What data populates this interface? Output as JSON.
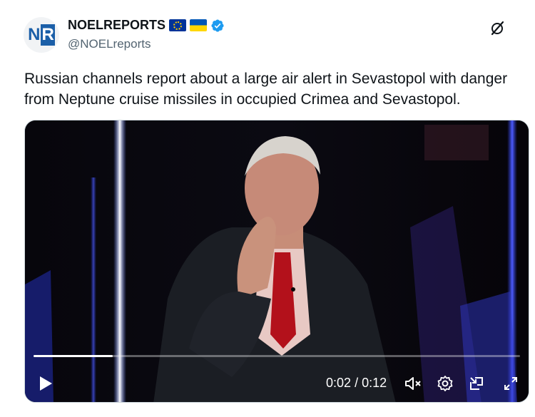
{
  "author": {
    "display_name": "NOELREPORTS",
    "handle": "@NOELreports",
    "avatar_text_left": "N",
    "avatar_text_right": "R",
    "badges": [
      "eu-flag-icon",
      "ukraine-flag-icon",
      "verified-badge-icon"
    ]
  },
  "tweet": {
    "text": "Russian channels report about a large air alert in Sevastopol with danger from Neptune cruise missiles in occupied Crimea and Sevastopol."
  },
  "video": {
    "current_time": "0:02",
    "separator": "/",
    "duration": "0:12",
    "progress_fraction": 0.163,
    "muted": true
  },
  "colors": {
    "text_primary": "#0f1419",
    "text_secondary": "#536471",
    "verified_blue": "#1d9bf0",
    "video_bg": "#050509"
  },
  "icons": {
    "grok": "grok-slash-circle-icon",
    "play": "play-icon",
    "mute": "speaker-muted-icon",
    "settings": "gear-icon",
    "pip": "picture-in-picture-icon",
    "fullscreen": "fullscreen-expand-icon"
  }
}
